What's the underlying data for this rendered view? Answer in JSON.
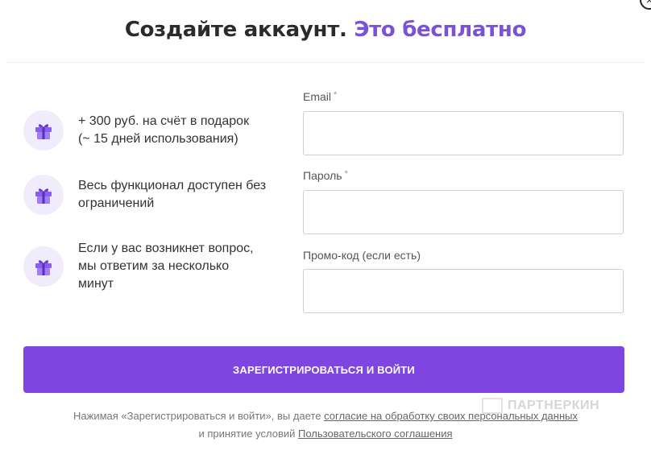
{
  "close_label": "×",
  "header": {
    "title_main": "Создайте аккаунт.",
    "title_accent": "Это бесплатно"
  },
  "benefits": [
    {
      "icon": "gift-icon",
      "text": "+ 300 руб. на счёт в подарок\n(~ 15 дней использования)"
    },
    {
      "icon": "gift-icon",
      "text": "Весь функционал доступен без\nограничений"
    },
    {
      "icon": "gift-icon",
      "text": "Если у вас возникнет вопрос,\nмы ответим за несколько\nминут"
    }
  ],
  "form": {
    "email_label": "Email",
    "email_required": "*",
    "email_value": "",
    "password_label": "Пароль",
    "password_required": "*",
    "password_value": "",
    "promo_label": "Промо-код (если есть)",
    "promo_value": "",
    "submit_label": "ЗАРЕГИСТРИРОВАТЬСЯ И ВОЙТИ"
  },
  "legal": {
    "line1_prefix": "Нажимая «Зарегистрироваться и войти», вы даете",
    "line1_link": "согласие на обработку своих персональных данных",
    "line2_prefix": "и принятие условий",
    "line2_link": "Пользовательского соглашения"
  },
  "watermark": "ПАРТНЕРКИН",
  "colors": {
    "accent": "#7b52d6",
    "button": "#7e45e0",
    "icon_bg": "#f0ecfb"
  }
}
